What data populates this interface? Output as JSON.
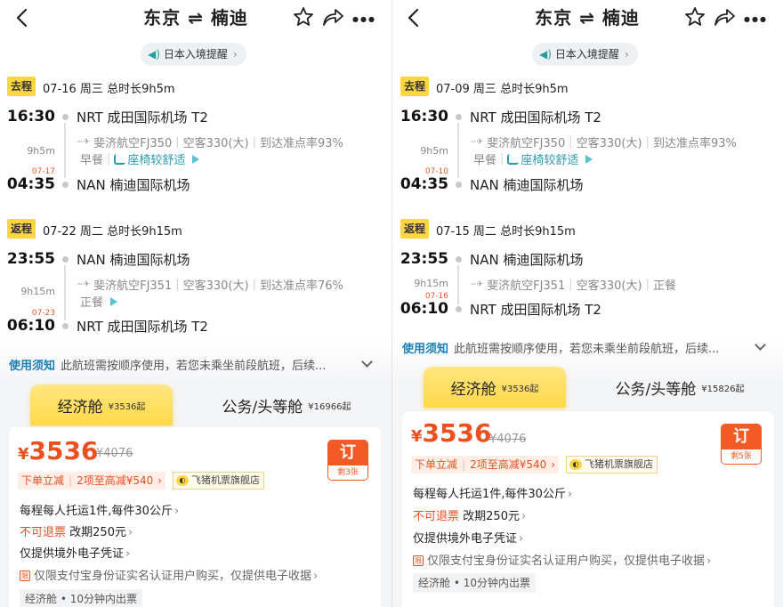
{
  "panels": [
    {
      "title": "东京 ⇌ 楠迪",
      "notice": "日本入境提醒",
      "outbound": {
        "tag": "去程",
        "date": "07-16",
        "weekday": "周三",
        "duration_label": "总时长9h5m",
        "dep_time": "16:30",
        "dep_airport": "NRT 成田国际机场 T2",
        "seg_duration": "9h5m",
        "airline": "斐济航空FJ350",
        "aircraft": "空客330(大)",
        "ontime": "到达准点率93%",
        "meal": "早餐",
        "comfort": "座椅较舒适",
        "next_day": "07-17",
        "arr_time": "04:35",
        "arr_airport": "NAN 楠迪国际机场"
      },
      "inbound": {
        "tag": "返程",
        "date": "07-22",
        "weekday": "周二",
        "duration_label": "总时长9h15m",
        "dep_time": "23:55",
        "dep_airport": "NAN 楠迪国际机场",
        "seg_duration": "9h15m",
        "airline": "斐济航空FJ351",
        "aircraft": "空客330(大)",
        "ontime": "到达准点率76%",
        "meal": "正餐",
        "next_day": "07-23",
        "arr_time": "06:10",
        "arr_airport": "NRT 成田国际机场 T2"
      },
      "usage_label": "使用须知",
      "usage_text": "此航班需按顺序使用，若您未乘坐前段航班，后续...",
      "cabins": [
        {
          "name": "经济舱",
          "price": "¥3536起"
        },
        {
          "name": "公务/头等舱",
          "price": "¥16966起"
        }
      ],
      "price_yen": "¥",
      "price": "3536",
      "old_price": "¥4076",
      "promo_1": "下单立减",
      "promo_2": "2项至高减¥540",
      "store": "飞猪机票旗舰店",
      "book_label": "订",
      "book_remaining": "剩3张",
      "baggage": "每程每人托运1件,每件30公斤",
      "refund_red": "不可退票",
      "refund_rest": "改期250元",
      "voucher": "仅提供境外电子凭证",
      "limit_badge": "限",
      "limit_text": "仅限支付宝身份证实名认证用户购买，仅提供电子收据",
      "ticket_note": "经济舱 • 10分钟内出票"
    },
    {
      "title": "东京 ⇌ 楠迪",
      "notice": "日本入境提醒",
      "outbound": {
        "tag": "去程",
        "date": "07-09",
        "weekday": "周三",
        "duration_label": "总时长9h5m",
        "dep_time": "16:30",
        "dep_airport": "NRT 成田国际机场 T2",
        "seg_duration": "9h5m",
        "airline": "斐济航空FJ350",
        "aircraft": "空客330(大)",
        "ontime": "到达准点率93%",
        "meal": "早餐",
        "comfort": "座椅较舒适",
        "next_day": "07-10",
        "arr_time": "04:35",
        "arr_airport": "NAN 楠迪国际机场"
      },
      "inbound": {
        "tag": "返程",
        "date": "07-15",
        "weekday": "周二",
        "duration_label": "总时长9h15m",
        "dep_time": "23:55",
        "dep_airport": "NAN 楠迪国际机场",
        "seg_duration": "9h15m",
        "airline": "斐济航空FJ351",
        "aircraft": "空客330(大)",
        "meal": "正餐",
        "next_day": "07-16",
        "arr_time": "06:10",
        "arr_airport": "NRT 成田国际机场 T2"
      },
      "usage_label": "使用须知",
      "usage_text": "此航班需按顺序使用，若您未乘坐前段航班，后续...",
      "cabins": [
        {
          "name": "经济舱",
          "price": "¥3536起"
        },
        {
          "name": "公务/头等舱",
          "price": "¥15826起"
        }
      ],
      "price_yen": "¥",
      "price": "3536",
      "old_price": "¥4076",
      "promo_1": "下单立减",
      "promo_2": "2项至高减¥540",
      "store": "飞猪机票旗舰店",
      "book_label": "订",
      "book_remaining": "剩5张",
      "baggage": "每程每人托运1件,每件30公斤",
      "refund_red": "不可退票",
      "refund_rest": "改期250元",
      "voucher": "仅提供境外电子凭证",
      "limit_badge": "限",
      "limit_text": "仅限支付宝身份证实名认证用户购买，仅提供电子收据",
      "ticket_note": "经济舱 • 10分钟内出票"
    }
  ]
}
